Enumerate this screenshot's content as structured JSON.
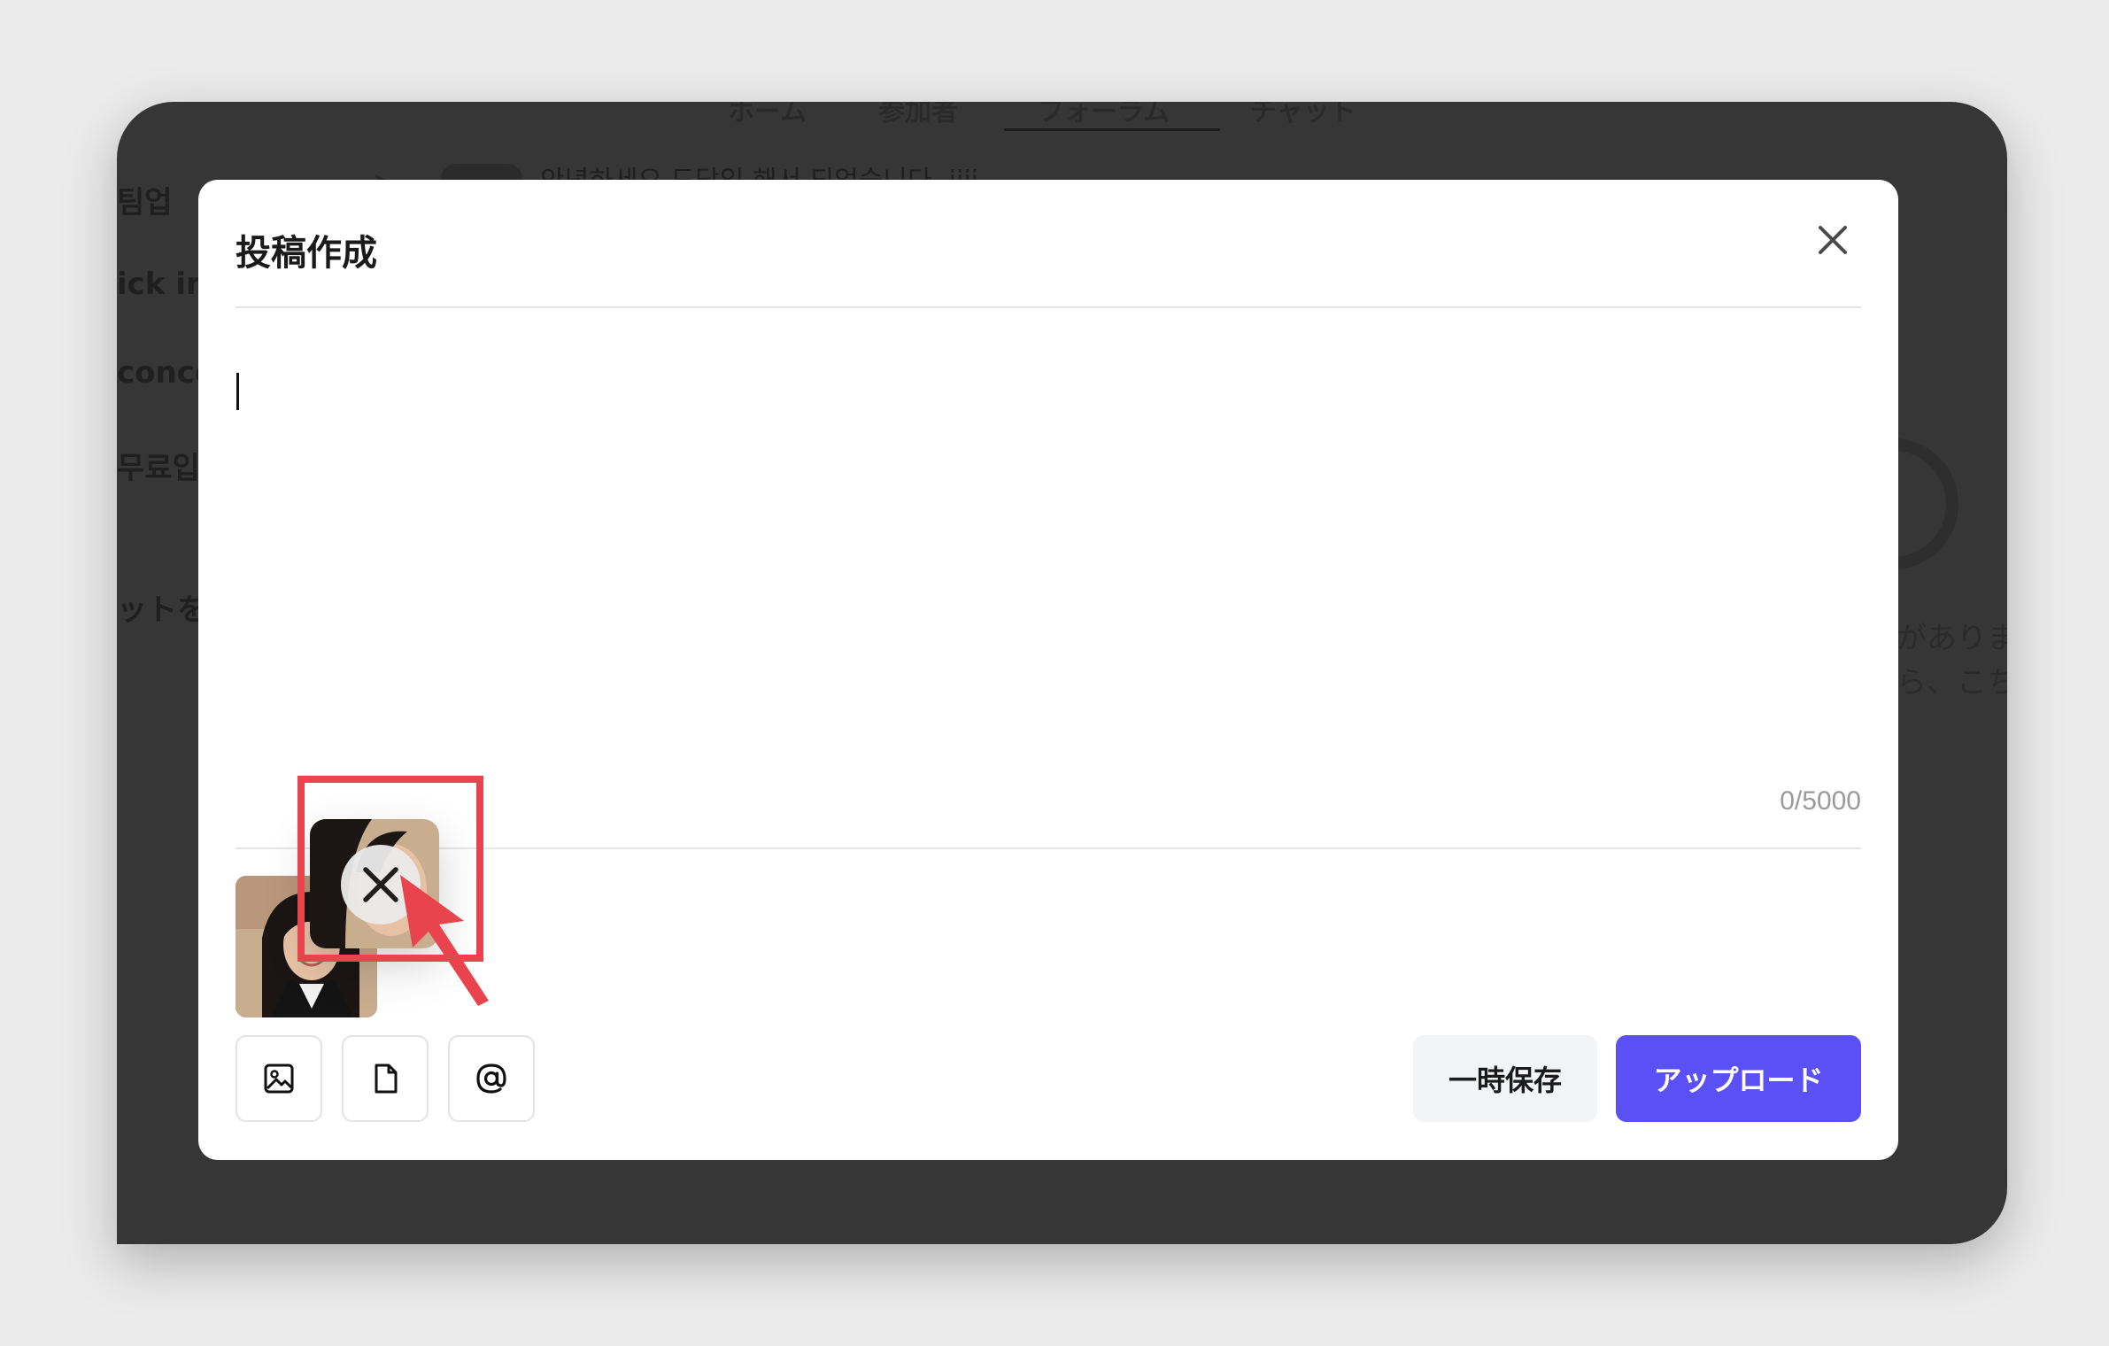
{
  "background": {
    "tabs": [
      "ホーム",
      "参加者",
      "フォーラム",
      "チャット"
    ],
    "left_texts": [
      "팀업",
      "ick in T",
      "conce",
      "무료입",
      "ットを生"
    ],
    "right_texts": [
      "があります",
      "ら、こち"
    ],
    "post_preview": "안녕하세요 도담입 해서 되었습니다. iiii"
  },
  "modal": {
    "title": "投稿作成",
    "textarea": {
      "value": "",
      "placeholder": ""
    },
    "counter": "0/5000",
    "toolbar": {
      "image_icon": "image-icon",
      "file_icon": "file-icon",
      "mention_icon": "at-icon"
    },
    "save_label": "一時保存",
    "upload_label": "アップロード"
  },
  "colors": {
    "accent": "#5b50f5",
    "highlight": "#e9444d",
    "backdrop": "#363636"
  }
}
